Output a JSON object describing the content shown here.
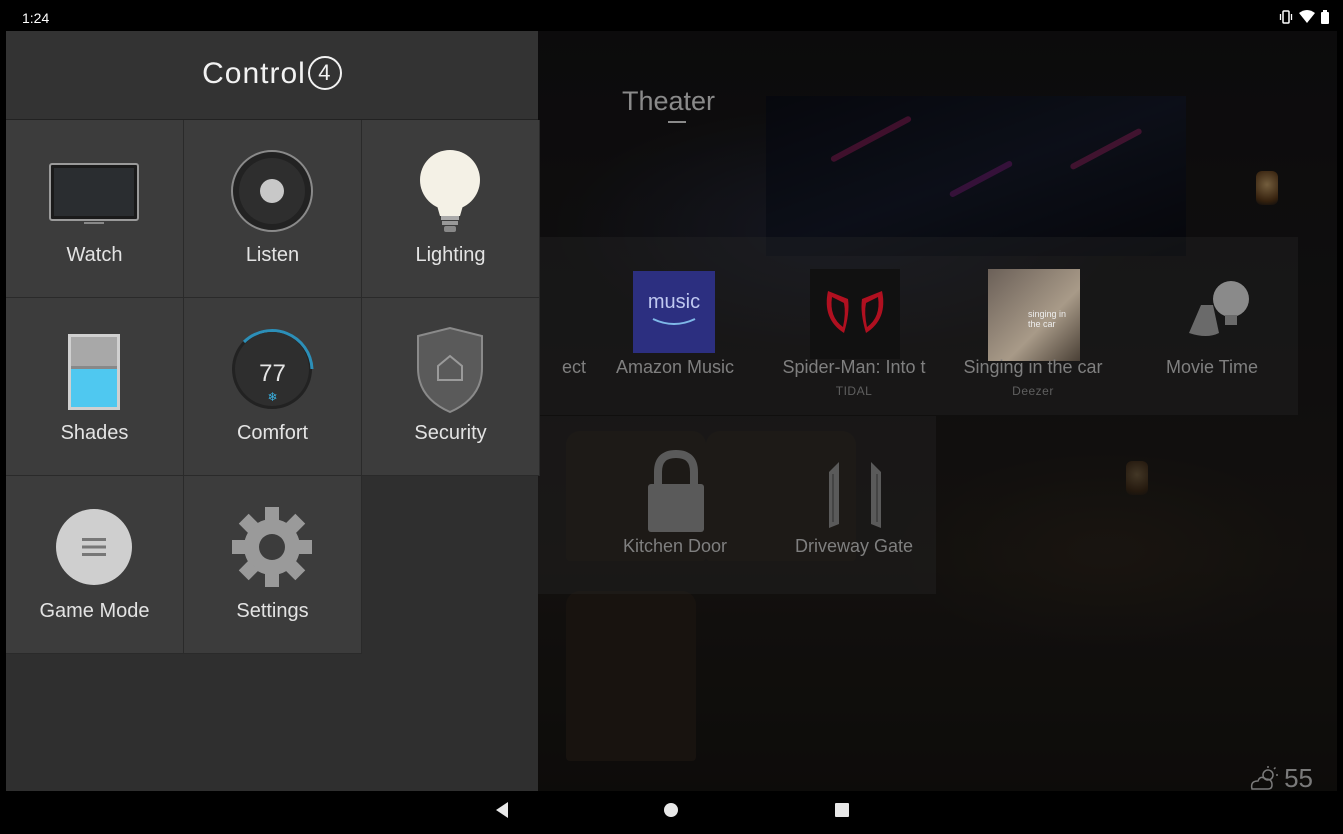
{
  "status_bar": {
    "time": "1:24",
    "icons": [
      "vibrate-icon",
      "wifi-icon",
      "battery-icon"
    ]
  },
  "drawer": {
    "brand": "Control",
    "brand_mark": "4",
    "tiles": [
      {
        "label": "Watch",
        "icon": "tv-icon"
      },
      {
        "label": "Listen",
        "icon": "speaker-icon"
      },
      {
        "label": "Lighting",
        "icon": "lightbulb-icon"
      },
      {
        "label": "Shades",
        "icon": "shade-icon"
      },
      {
        "label": "Comfort",
        "icon": "thermostat-icon",
        "value": "77",
        "value_icon": "snowflake-icon"
      },
      {
        "label": "Security",
        "icon": "shield-icon"
      },
      {
        "label": "Game Mode",
        "icon": "menu-circle-icon"
      },
      {
        "label": "Settings",
        "icon": "gear-icon"
      }
    ]
  },
  "room": {
    "title": "Theater"
  },
  "favorites": {
    "row1": [
      {
        "title": "ect",
        "subtitle": ""
      },
      {
        "title": "Amazon Music",
        "subtitle": "",
        "art_text": "music"
      },
      {
        "title": "Spider-Man: Into t",
        "subtitle": "TIDAL"
      },
      {
        "title": "Singing in the car",
        "subtitle": "Deezer",
        "art_text": "singing in the car"
      },
      {
        "title": "Movie Time",
        "subtitle": ""
      }
    ],
    "row2": [
      {
        "title": "Kitchen Door",
        "subtitle": ""
      },
      {
        "title": "Driveway Gate",
        "subtitle": ""
      }
    ]
  },
  "weather": {
    "temperature": "55",
    "icon": "partly-cloudy-icon"
  },
  "nav_bar": {
    "buttons": [
      "back-button",
      "home-button",
      "recents-button"
    ]
  },
  "colors": {
    "drawer_bg": "#2f2f2f",
    "tile_bg": "#3c3c3c",
    "comfort_accent": "#3ab0e0",
    "shade_blue": "#4fc8f0"
  }
}
